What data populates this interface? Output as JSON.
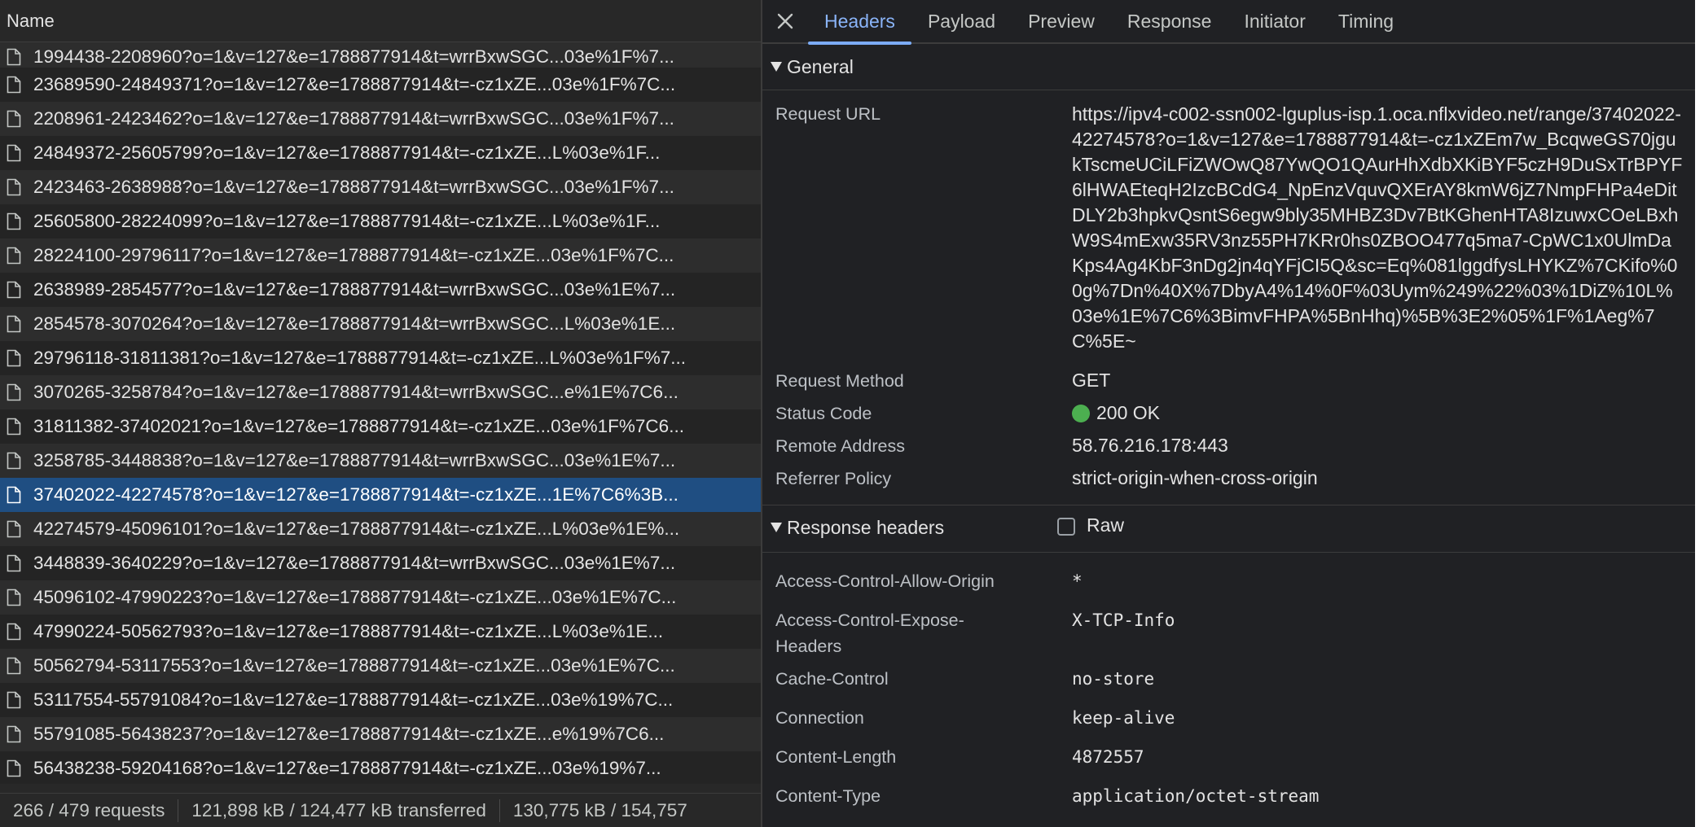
{
  "left": {
    "column_header": "Name",
    "rows": [
      "1994438-2208960?o=1&v=127&e=1788877914&t=wrrBxwSGC...03e%1F%7...",
      "23689590-24849371?o=1&v=127&e=1788877914&t=-cz1xZE...03e%1F%7C...",
      "2208961-2423462?o=1&v=127&e=1788877914&t=wrrBxwSGC...03e%1F%7...",
      "24849372-25605799?o=1&v=127&e=1788877914&t=-cz1xZE...L%03e%1F...",
      "2423463-2638988?o=1&v=127&e=1788877914&t=wrrBxwSGC...03e%1F%7...",
      "25605800-28224099?o=1&v=127&e=1788877914&t=-cz1xZE...L%03e%1F...",
      "28224100-29796117?o=1&v=127&e=1788877914&t=-cz1xZE...03e%1F%7C...",
      "2638989-2854577?o=1&v=127&e=1788877914&t=wrrBxwSGC...03e%1E%7...",
      "2854578-3070264?o=1&v=127&e=1788877914&t=wrrBxwSGC...L%03e%1E...",
      "29796118-31811381?o=1&v=127&e=1788877914&t=-cz1xZE...L%03e%1F%7...",
      "3070265-3258784?o=1&v=127&e=1788877914&t=wrrBxwSGC...e%1E%7C6...",
      "31811382-37402021?o=1&v=127&e=1788877914&t=-cz1xZE...03e%1F%7C6...",
      "3258785-3448838?o=1&v=127&e=1788877914&t=wrrBxwSGC...03e%1E%7...",
      "37402022-42274578?o=1&v=127&e=1788877914&t=-cz1xZE...1E%7C6%3B...",
      "42274579-45096101?o=1&v=127&e=1788877914&t=-cz1xZE...L%03e%1E%...",
      "3448839-3640229?o=1&v=127&e=1788877914&t=wrrBxwSGC...03e%1E%7...",
      "45096102-47990223?o=1&v=127&e=1788877914&t=-cz1xZE...03e%1E%7C...",
      "47990224-50562793?o=1&v=127&e=1788877914&t=-cz1xZE...L%03e%1E...",
      "50562794-53117553?o=1&v=127&e=1788877914&t=-cz1xZE...03e%1E%7C...",
      "53117554-55791084?o=1&v=127&e=1788877914&t=-cz1xZE...03e%19%7C...",
      "55791085-56438237?o=1&v=127&e=1788877914&t=-cz1xZE...e%19%7C6...",
      "56438238-59204168?o=1&v=127&e=1788877914&t=-cz1xZE...03e%19%7..."
    ],
    "selected_row": "37402022-42274578?o=1&v=127&e=1788877914&t=-cz1xZE...1E%7C6%3B..."
  },
  "statusbar": {
    "requests": "266 / 479 requests",
    "transferred": "121,898 kB / 124,477 kB transferred",
    "resources": "130,775 kB / 154,757"
  },
  "tabs": [
    "Headers",
    "Payload",
    "Preview",
    "Response",
    "Initiator",
    "Timing"
  ],
  "active_tab": "Headers",
  "general": {
    "title": "General",
    "request_url_label": "Request URL",
    "request_url": "https://ipv4-c002-ssn002-lguplus-isp.1.oca.nflxvideo.net/range/37402022-42274578?o=1&v=127&e=1788877914&t=-cz1xZEm7w_BcqweGS70jgukTscmeUCiLFiZWOwQ87YwQO1QAurHhXdbXKiBYF5czH9DuSxTrBPYF6lHWAEteqH2IzcBCdG4_NpEnzVquvQXErAY8kmW6jZ7NmpFHPa4eDitDLY2b3hpkvQsntS6egw9bly35MHBZ3Dv7BtKGhenHTA8IzuwxCOeLBxhW9S4mExw35RV3nz55PH7KRr0hs0ZBOO477q5ma7-CpWC1x0UlmDaKps4Ag4KbF3nDg2jn4qYFjCI5Q&sc=Eq%081lggdfysLHYKZ%7CKifo%00g%7Dn%40X%7DbyA4%14%0F%03Uym%249%22%03%1DiZ%10L%03e%1E%7C6%3BimvFHPA%5BnHhq)%5B%3E2%05%1F%1Aeg%7C%5E~",
    "request_method_label": "Request Method",
    "request_method": "GET",
    "status_code_label": "Status Code",
    "status_code": "200 OK",
    "remote_address_label": "Remote Address",
    "remote_address": "58.76.216.178:443",
    "referrer_policy_label": "Referrer Policy",
    "referrer_policy": "strict-origin-when-cross-origin"
  },
  "response_headers": {
    "title": "Response headers",
    "raw_label": "Raw",
    "raw_checked": false,
    "items": [
      {
        "name": "Access-Control-Allow-Origin",
        "value": "*"
      },
      {
        "name": "Access-Control-Expose-Headers",
        "value": "X-TCP-Info"
      },
      {
        "name": "Cache-Control",
        "value": "no-store"
      },
      {
        "name": "Connection",
        "value": "keep-alive"
      },
      {
        "name": "Content-Length",
        "value": "4872557"
      },
      {
        "name": "Content-Type",
        "value": "application/octet-stream"
      }
    ]
  },
  "colors": {
    "selected_row": "#1f4e82",
    "active_tab": "#8ab4f8",
    "status_ok": "#4caf50"
  }
}
